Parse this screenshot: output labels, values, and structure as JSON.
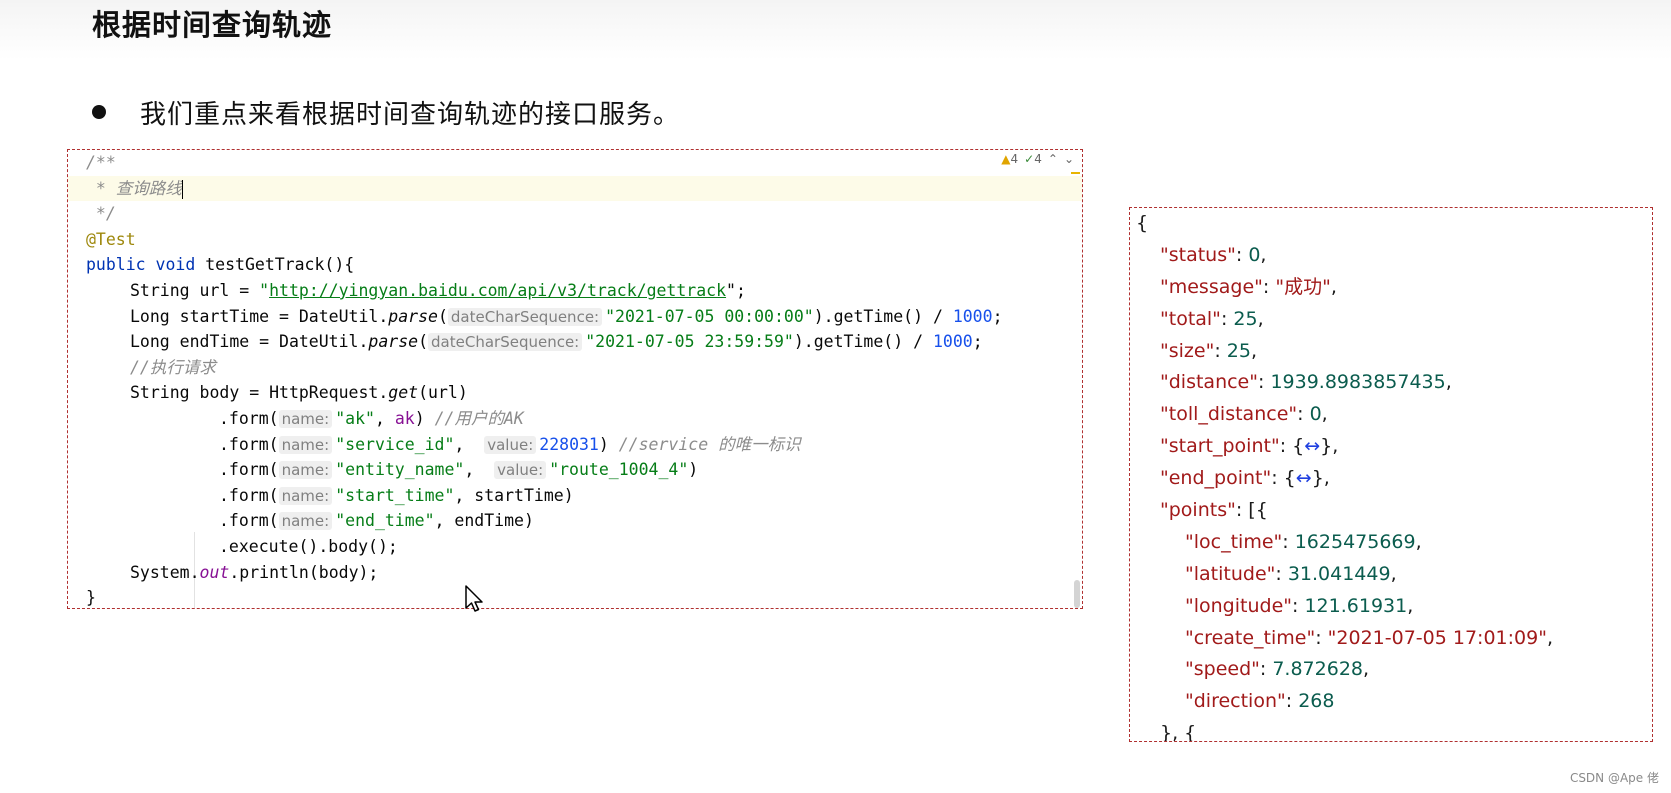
{
  "slide": {
    "title": "根据时间查询轨迹",
    "bullet": "我们重点来看根据时间查询轨迹的接口服务。"
  },
  "editor": {
    "inspection": {
      "warnings": "4",
      "checks": "4"
    },
    "comment_open": "/**",
    "comment_line": " * 查询路线",
    "comment_close": " */",
    "annotation": "@Test",
    "sig_kw": "public void",
    "sig_method": " testGetTrack",
    "sig_rest": "(){",
    "url_decl": "String url = ",
    "url_q1": "\"",
    "url_value": "http://yingyan.baidu.com/api/v3/track/gettrack",
    "url_end": "\";",
    "start_a": "Long startTime = DateUtil.",
    "parse_method": "parse",
    "open_paren": "(",
    "hint_date": "dateCharSequence:",
    "start_date": "\"2021-07-05 00:00:00\"",
    "mid_gettime": ").getTime() / ",
    "num_1000": "1000",
    "start_end": ";",
    "end_a": "Long endTime = DateUtil.",
    "end_date": "\"2021-07-05 23:59:59\"",
    "end_end": ";",
    "exec_comment": "//执行请求",
    "body_a": "String body = HttpRequest.",
    "get_method": "get",
    "body_b": "(url)",
    "form_open": ".form(",
    "hint_name": "name:",
    "hint_value": "value:",
    "ak_key": "\"ak\"",
    "ak_sep": ", ",
    "ak_var": "ak",
    "ak_close": ") ",
    "ak_comment": "//用户的AK",
    "sid_key": "\"service_id\"",
    "sid_sep": ",  ",
    "sid_value": "228031",
    "sid_close": ") ",
    "sid_comment": "//service 的唯一标识",
    "en_key": "\"entity_name\"",
    "en_sep": ",  ",
    "en_value": "\"route_1004_4\"",
    "en_close": ")",
    "st_key": "\"start_time\"",
    "st_rest": ", startTime)",
    "et_key": "\"end_time\"",
    "et_rest": ", endTime)",
    "execute_line": ".execute().body();",
    "print_a": "System.",
    "print_out": "out",
    "print_b": ".println(body);",
    "close_brace": "}"
  },
  "json": {
    "open": "{",
    "status_k": "\"status\"",
    "status_v": "0",
    "message_k": "\"message\"",
    "message_v": "\"成功\"",
    "total_k": "\"total\"",
    "total_v": "25",
    "size_k": "\"size\"",
    "size_v": "25",
    "distance_k": "\"distance\"",
    "distance_v": "1939.8983857435",
    "toll_k": "\"toll_distance\"",
    "toll_v": "0",
    "start_point_k": "\"start_point\"",
    "end_point_k": "\"end_point\"",
    "expand": "↔",
    "points_k": "\"points\"",
    "loc_time_k": "\"loc_time\"",
    "loc_time_v": "1625475669",
    "latitude_k": "\"latitude\"",
    "latitude_v": "31.041449",
    "longitude_k": "\"longitude\"",
    "longitude_v": "121.61931",
    "create_time_k": "\"create_time\"",
    "create_time_v": "\"2021-07-05 17:01:09\"",
    "speed_k": "\"speed\"",
    "speed_v": "7.872628",
    "direction_k": "\"direction\"",
    "direction_v": "268",
    "next_item": "}, {"
  },
  "watermark": "CSDN @Ape 佬"
}
